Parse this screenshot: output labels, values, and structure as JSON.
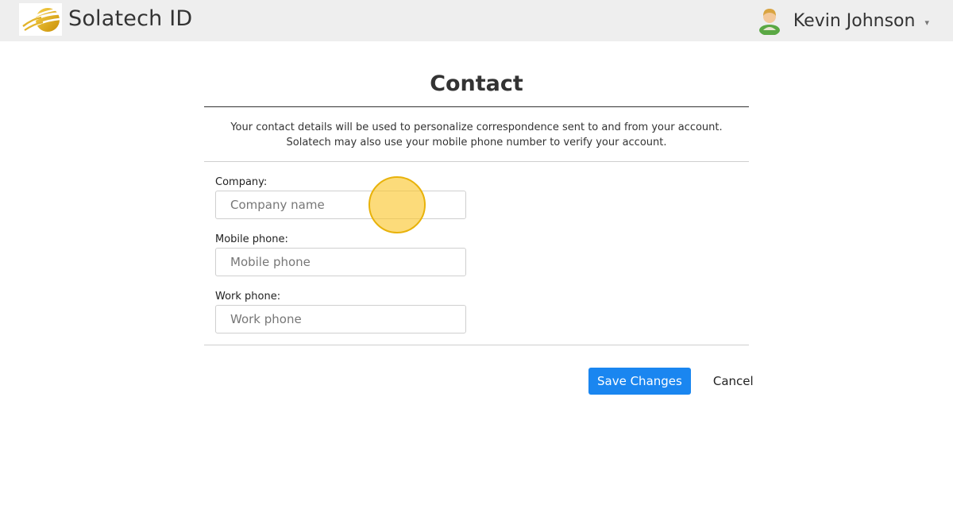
{
  "header": {
    "app_title": "Solatech ID",
    "logo_icon": "solatech-sun-logo",
    "user": {
      "name": "Kevin Johnson",
      "avatar_icon": "user-avatar-icon",
      "caret": "▾"
    }
  },
  "page": {
    "title": "Contact",
    "intro_line1": "Your contact details will be used to personalize correspondence sent to and from your account.",
    "intro_line2": "Solatech may also use your mobile phone number to verify your account."
  },
  "form": {
    "company": {
      "label": "Company:",
      "value": "",
      "placeholder": "Company name"
    },
    "mobile": {
      "label": "Mobile phone:",
      "value": "",
      "placeholder": "Mobile phone"
    },
    "work": {
      "label": "Work phone:",
      "value": "",
      "placeholder": "Work phone"
    }
  },
  "actions": {
    "save_label": "Save Changes",
    "cancel_label": "Cancel"
  },
  "colors": {
    "header_bg": "#eeeeee",
    "primary": "#1a86f0",
    "logo_gold": "#e0ab16",
    "cursor_highlight": "#f5c53a"
  }
}
